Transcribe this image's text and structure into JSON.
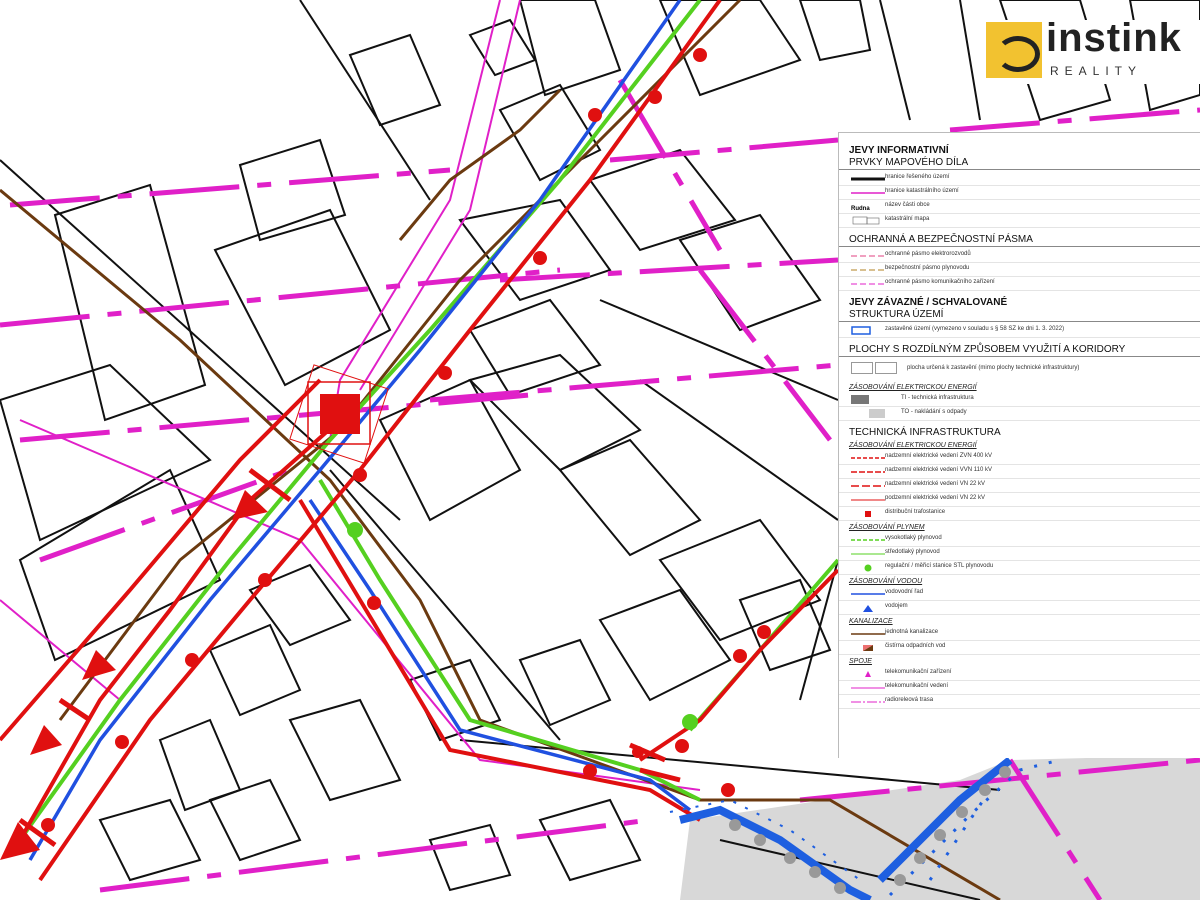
{
  "logo": {
    "name": "instink",
    "sub": "REALITY"
  },
  "legend": {
    "informativni": {
      "title": "JEVY INFORMATIVNÍ",
      "section1": "PRVKY MAPOVÉHO DÍLA",
      "items1": [
        "hranice řešeného území",
        "hranice katastrálního území",
        "název části obce",
        "katastrální mapa"
      ],
      "section2": "OCHRANNÁ A BEZPEČNOSTNÍ PÁSMA",
      "items2": [
        "ochranné pásmo elektrorozvodů",
        "bezpečnostní pásmo plynovodu",
        "ochranné pásmo komunikačního zařízení"
      ]
    },
    "zavazne": {
      "title": "JEVY ZÁVAZNÉ / SCHVALOVANÉ",
      "section1": "STRUKTURA ÚZEMÍ",
      "item_zastavene": "zastavěné území (vymezeno v souladu s § 58 SZ ke dni 1. 3. 2022)",
      "section2": "PLOCHY S ROZDÍLNÝM ZPŮSOBEM VYUŽITÍ A KORIDORY",
      "item_plocha": "plocha určená k zastavění (mimo plochy technické infrastruktury)",
      "sub_energie": "ZÁSOBOVÁNÍ ELEKTRICKOU ENERGIÍ",
      "item_ti": "TI - technická infrastruktura",
      "item_to": "TO - nakládání s odpady"
    },
    "technicka": {
      "title": "TECHNICKÁ INFRASTRUKTURA",
      "sub_energie": "ZÁSOBOVÁNÍ ELEKTRICKOU ENERGIÍ",
      "energie": [
        "nadzemní elektrické vedení ZVN 400 kV",
        "nadzemní elektrické vedení VVN 110 kV",
        "nadzemní elektrické vedení VN 22 kV",
        "podzemní elektrické vedení VN 22 kV",
        "distribuční trafostanice"
      ],
      "sub_plyn": "ZÁSOBOVÁNÍ PLYNEM",
      "plyn": [
        "vysokotlaký plynovod",
        "středotlaký plynovod",
        "regulační / měřicí stanice STL plynovodu"
      ],
      "sub_voda": "ZÁSOBOVÁNÍ VODOU",
      "voda": [
        "vodovodní řad",
        "vodojem"
      ],
      "sub_kanal": "KANALIZACE",
      "kanal": [
        "jednotná kanalizace",
        "čistírna odpadních vod"
      ],
      "sub_spoje": "SPOJE",
      "spoje": [
        "telekomunikační zařízení",
        "telekomunikační vedení",
        "radioreleová trasa"
      ]
    }
  },
  "colors": {
    "magenta": "#e020c8",
    "electric": "#e01010",
    "gas": "#55d020",
    "water": "#2050e0",
    "sewer": "#6b3a10",
    "parcel": "#111111",
    "built_area": "#1e5fe0",
    "plot_grey": "#d8d8d8"
  }
}
